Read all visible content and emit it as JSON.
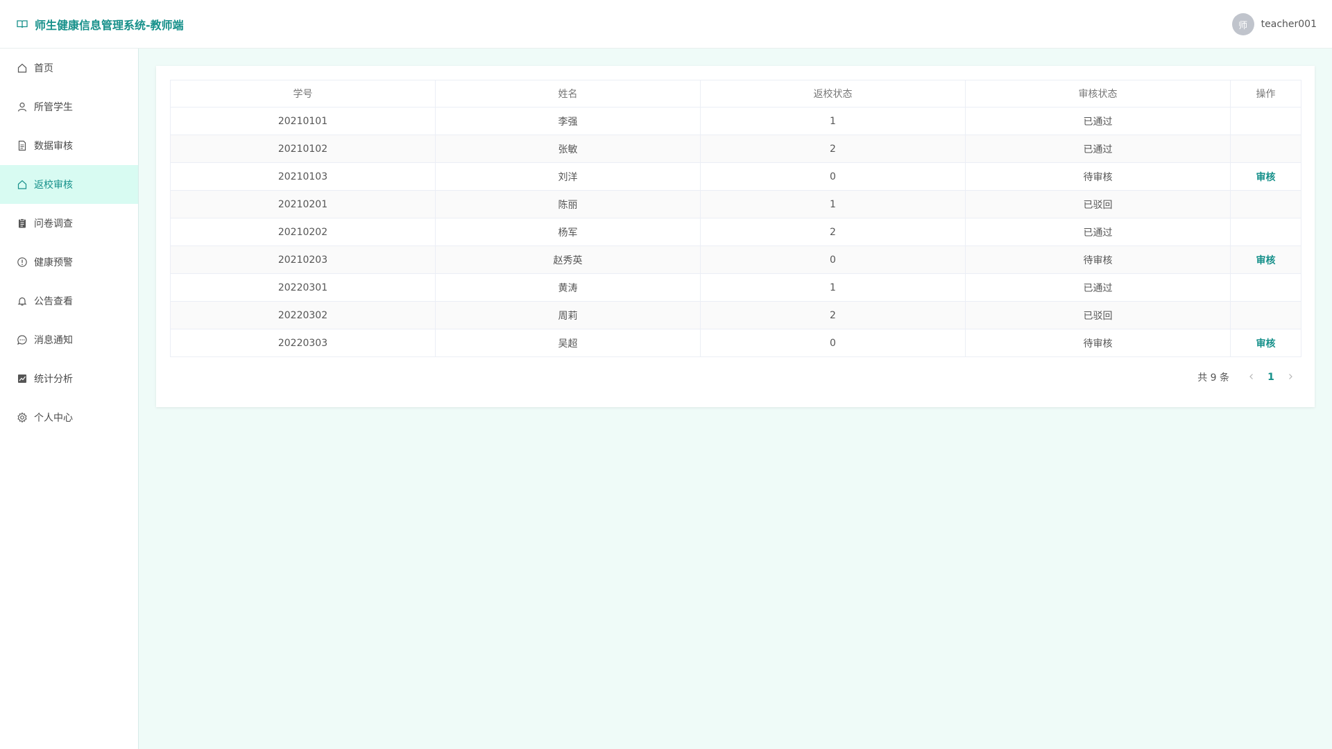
{
  "header": {
    "title": "师生健康信息管理系统-教师端",
    "avatar_text": "师",
    "username": "teacher001"
  },
  "sidebar": {
    "items": [
      {
        "label": "首页",
        "icon": "home-icon"
      },
      {
        "label": "所管学生",
        "icon": "user-icon"
      },
      {
        "label": "数据审核",
        "icon": "document-icon"
      },
      {
        "label": "返校审核",
        "icon": "home-icon",
        "active": true
      },
      {
        "label": "问卷调查",
        "icon": "clipboard-icon"
      },
      {
        "label": "健康预警",
        "icon": "warning-circle-icon"
      },
      {
        "label": "公告查看",
        "icon": "bell-icon"
      },
      {
        "label": "消息通知",
        "icon": "chat-icon"
      },
      {
        "label": "统计分析",
        "icon": "chart-icon"
      },
      {
        "label": "个人中心",
        "icon": "gear-icon"
      }
    ]
  },
  "table": {
    "columns": [
      "学号",
      "姓名",
      "返校状态",
      "审核状态",
      "操作"
    ],
    "rows": [
      {
        "id": "20210101",
        "name": "李强",
        "return_status": "1",
        "review_status": "已通过",
        "action": ""
      },
      {
        "id": "20210102",
        "name": "张敏",
        "return_status": "2",
        "review_status": "已通过",
        "action": ""
      },
      {
        "id": "20210103",
        "name": "刘洋",
        "return_status": "0",
        "review_status": "待审核",
        "action": "审核"
      },
      {
        "id": "20210201",
        "name": "陈丽",
        "return_status": "1",
        "review_status": "已驳回",
        "action": ""
      },
      {
        "id": "20210202",
        "name": "杨军",
        "return_status": "2",
        "review_status": "已通过",
        "action": ""
      },
      {
        "id": "20210203",
        "name": "赵秀英",
        "return_status": "0",
        "review_status": "待审核",
        "action": "审核"
      },
      {
        "id": "20220301",
        "name": "黄涛",
        "return_status": "1",
        "review_status": "已通过",
        "action": ""
      },
      {
        "id": "20220302",
        "name": "周莉",
        "return_status": "2",
        "review_status": "已驳回",
        "action": ""
      },
      {
        "id": "20220303",
        "name": "吴超",
        "return_status": "0",
        "review_status": "待审核",
        "action": "审核"
      }
    ]
  },
  "pagination": {
    "total_text": "共 9 条",
    "current_page": "1",
    "prev_icon": "chevron-left-icon",
    "next_icon": "chevron-right-icon"
  },
  "colors": {
    "accent": "#16908a",
    "active_bg": "#d8fbf2",
    "main_bg": "#effbf8"
  }
}
